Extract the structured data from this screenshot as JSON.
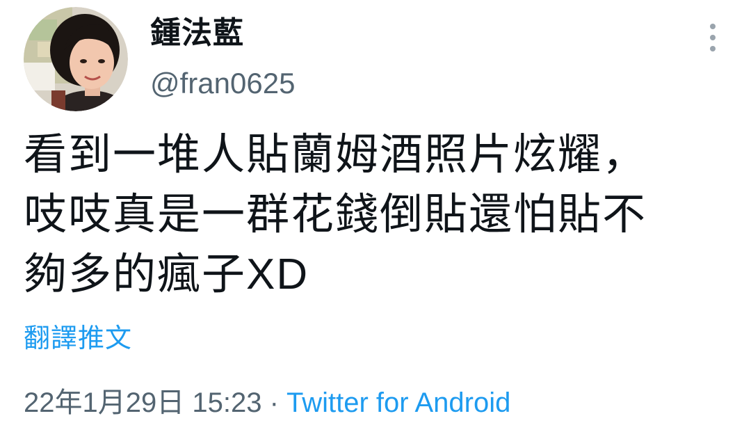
{
  "user": {
    "display_name": "鍾法藍",
    "handle": "@fran0625"
  },
  "tweet": {
    "text": "看到一堆人貼蘭姆酒照片炫耀，\n吱吱真是一群花錢倒貼還怕貼不\n夠多的瘋子XD",
    "translate_label": "翻譯推文",
    "timestamp": "22年1月29日 15:23",
    "separator": " · ",
    "source": "Twitter for Android"
  },
  "icons": {
    "more": "more-vertical-icon"
  },
  "colors": {
    "link": "#1d9bf0",
    "secondary_text": "#536471",
    "primary_text": "#0f1419"
  }
}
